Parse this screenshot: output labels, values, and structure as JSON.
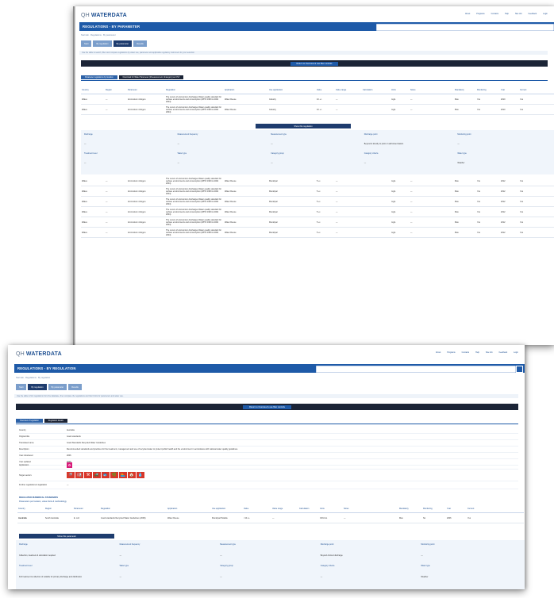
{
  "brand": {
    "prefix": "QH",
    "name": "WATERDATA"
  },
  "top_nav": [
    "About",
    "Programs",
    "Contacts",
    "Help",
    "Site info",
    "Feedback",
    "Login"
  ],
  "sheet_top": {
    "title": "REGULATIONS - BY PARAMETER",
    "breadcrumb": "Start tab · Regulations · By parameter",
    "tabs": [
      "Start",
      "By regulation",
      "By parameter",
      "Results"
    ],
    "active_tab": 2,
    "info": "Use the table to search, filter and compare regulations by water use, parameter and applicable regulatory instrument for your selection.",
    "export_label": "Return to Overview & use filter controls",
    "subtabs": [
      "Parameter regulations by location",
      "Download for Water Parameter (#measurement, #category) as CSV"
    ],
    "columns": [
      "Country",
      "Region",
      "Parameter",
      "Regulation",
      "Application",
      "Use application",
      "Value",
      "Value range",
      "Calculation",
      "Units",
      "Notes",
      "Mandatory",
      "Monitoring",
      "Year",
      "Current"
    ],
    "rows": [
      [
        "Wales",
        "—",
        "Ammonium nitrogen",
        "The Lorem of ammonium discharges Water quality standard for surface environments and consumption (WHO 1993 & 2002 2004)",
        "Water Reuse",
        "Industry",
        "10 +/-",
        "—",
        "mg/L",
        "—",
        "Max",
        "Yes",
        "2010",
        "Yes"
      ],
      [
        "Wales",
        "—",
        "Ammonium nitrogen",
        "The Lorem of ammonium discharges Water quality standard for surface environments and consumption (WHO 1993 & 2002 2004)",
        "Water Reuse",
        "Industry",
        "10 +/-",
        "—",
        "mg/L",
        "—",
        "Max",
        "Yes",
        "2010",
        "Yes"
      ]
    ],
    "view_button": "Show this regulation",
    "detail": {
      "labels": [
        "Discharge",
        "Measurement frequency",
        "Measurement type",
        "Discharge point",
        "Monitoring point"
      ],
      "values": [
        "—",
        "—",
        "—",
        "Beyond & directly to point or authorised station",
        "—"
      ],
      "labels2": [
        "Treatment level",
        "Water type",
        "Category group",
        "Category criteria",
        "Water type"
      ],
      "values2": [
        "—",
        "—",
        "—",
        "—",
        "Weather"
      ]
    },
    "rows_after": [
      [
        "Wales",
        "—",
        "Ammonium nitrogen",
        "The Lorem of ammonium discharges Water quality standard for surface environments and consumption (WHO 1993 & 2002 2004)",
        "Water Reuse",
        "Municipal",
        "5 +/-",
        "—",
        "mg/L",
        "—",
        "Max",
        "Yes",
        "2012",
        "Yes"
      ],
      [
        "Wales",
        "—",
        "Ammonium nitrogen",
        "The Lorem of ammonium discharges Water quality standard for surface environments and consumption (WHO 1993 & 2002 2004)",
        "Water Reuse",
        "Municipal",
        "5 +/-",
        "—",
        "mg/L",
        "—",
        "Max",
        "Yes",
        "2012",
        "Yes"
      ],
      [
        "Wales",
        "—",
        "Ammonium nitrogen",
        "The Lorem of ammonium discharges Water quality standard for surface environments and consumption (WHO 1993 & 2002 2004)",
        "Water Reuse",
        "Municipal",
        "5 +/-",
        "—",
        "mg/L",
        "—",
        "Max",
        "Yes",
        "2012",
        "Yes"
      ],
      [
        "Wales",
        "—",
        "Ammonium nitrogen",
        "The Lorem of ammonium discharges Water quality standard for surface environments and consumption (WHO 1993 & 2002 2004)",
        "Water Reuse",
        "Municipal",
        "5 +/-",
        "—",
        "mg/L",
        "—",
        "Max",
        "Yes",
        "2012",
        "Yes"
      ],
      [
        "Wales",
        "—",
        "Ammonium nitrogen",
        "The Lorem of ammonium discharges Water quality standard for surface environments and consumption (WHO 1993 & 2002 2004)",
        "Water Reuse",
        "Municipal",
        "5 +/-",
        "—",
        "mg/L",
        "—",
        "Max",
        "Yes",
        "2012",
        "Yes"
      ],
      [
        "Wales",
        "—",
        "Ammonium nitrogen",
        "The Lorem of ammonium discharges Water quality standard for surface environments and consumption (WHO 1993 & 2002 2004)",
        "Water Reuse",
        "Municipal",
        "5 +/-",
        "—",
        "mg/L",
        "—",
        "Max",
        "Yes",
        "2012",
        "Yes"
      ]
    ]
  },
  "sheet_bottom": {
    "title": "REGULATIONS - BY REGULATION",
    "breadcrumb": "Start tab · Regulations · By regulation",
    "tabs": [
      "Start",
      "By regulation",
      "By parameter",
      "Results"
    ],
    "active_tab": 1,
    "info": "Use the table to find regulations from the database, then compare the regulations and their limits for parameters and water use.",
    "export_label": "Return to Overview & use filter controls",
    "subtabs": [
      "Overview of regulation",
      "Regulation details"
    ],
    "kv": [
      [
        "Country",
        "Australia"
      ],
      [
        "Original title",
        "Good standards"
      ],
      [
        "Translated name",
        "Good Standards Recycled Water Guidelines"
      ],
      [
        "Description",
        "Recommended standards and practices for the treatment, management and use of recycled water to protect public health and the environment in accordance with national water quality guidelines."
      ],
      [
        "Year introduced",
        "2006"
      ],
      [
        "Year updated",
        "2008"
      ]
    ],
    "application_label": "Application",
    "target_label": "Target sectors",
    "further_label": "Further regulations & legislation",
    "further_value": "—",
    "target_icons": [
      "🚿",
      "🏭",
      "⚒",
      "🚜",
      "🐟",
      "🌿",
      "🏊",
      "🏠",
      "💧"
    ],
    "section_title": "REGULATED NUMERICAL STANDARDS",
    "section_sub": "Parameters per location, value limits & methodology",
    "columns": [
      "Country",
      "Region",
      "Parameter",
      "Regulation",
      "Application",
      "Use application",
      "Value",
      "Value range",
      "Calculation",
      "Units",
      "Notes",
      "Mandatory",
      "Monitoring",
      "Year",
      "Current"
    ],
    "row": [
      "Australia",
      "South Australia",
      "E. coli",
      "Good standards Recycled Water Guidelines (2006)",
      "Water Reuse",
      "Municipal Potable",
      "<10 +/-",
      "—",
      "CFU/mL",
      "—",
      "Max",
      "No",
      "2006",
      "Yes"
    ],
    "view_button": "Show this parameter",
    "detail": {
      "labels": [
        "Discharge",
        "Measurement frequency",
        "Measurement type",
        "Discharge point",
        "Monitoring point"
      ],
      "values": [
        "Collection, treatment & reticulation required",
        "—",
        "—",
        "Beyond & direct discharge",
        "—"
      ],
      "labels2": [
        "Treatment level",
        "Water type",
        "Category group",
        "Category criteria",
        "Water type"
      ],
      "values2": [
        "Full treatment & collection of suitable for primary discharge and distribution",
        "—",
        "—",
        "—",
        "Weather"
      ]
    }
  }
}
